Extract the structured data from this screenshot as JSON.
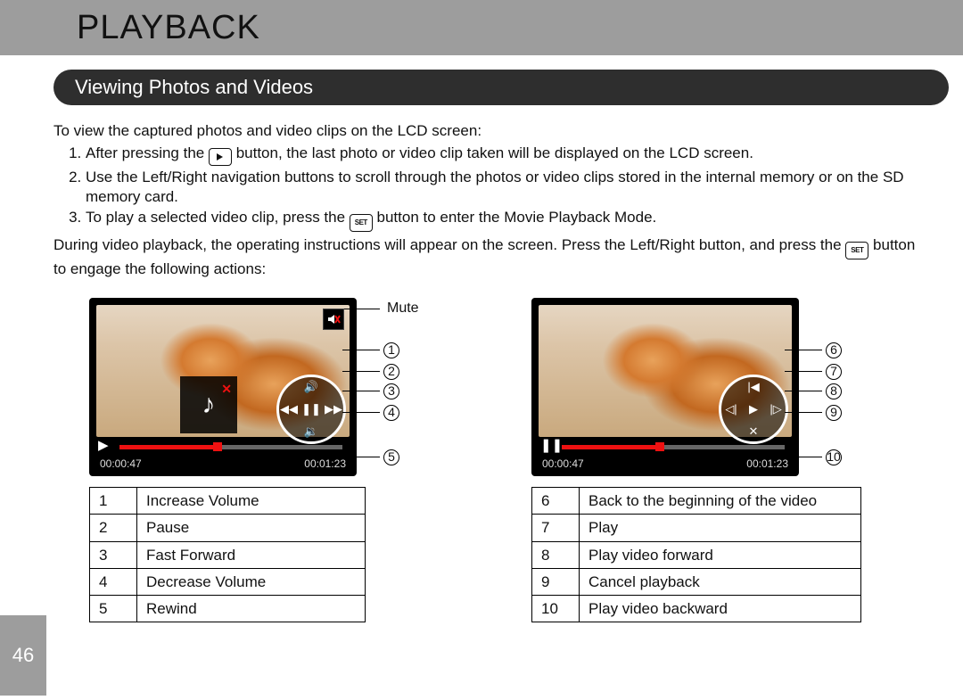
{
  "page_number": "46",
  "title": "PLAYBACK",
  "section_title": "Viewing Photos and Videos",
  "intro": "To view the captured photos and video clips on the LCD screen:",
  "step1_a": "After pressing the ",
  "step1_b": " button, the last photo or video clip taken will be displayed on the LCD screen.",
  "step2": "Use the Left/Right navigation buttons to scroll through the photos or video clips stored in the internal memory or on the SD memory card.",
  "step3_a": "To play a selected video clip, press the ",
  "step3_b": " button to enter the Movie Playback Mode.",
  "para2_a": "During video playback, the operating instructions will appear on the screen. Press the Left/Right button, and press the ",
  "para2_b": " button to engage the following actions:",
  "mute_label": "Mute",
  "time_elapsed": "00:00:47",
  "time_total": "00:01:23",
  "legend_left": [
    {
      "n": "1",
      "t": "Increase Volume"
    },
    {
      "n": "2",
      "t": "Pause"
    },
    {
      "n": "3",
      "t": "Fast Forward"
    },
    {
      "n": "4",
      "t": "Decrease Volume"
    },
    {
      "n": "5",
      "t": "Rewind"
    }
  ],
  "legend_right": [
    {
      "n": "6",
      "t": "Back to the beginning of the video"
    },
    {
      "n": "7",
      "t": "Play"
    },
    {
      "n": "8",
      "t": "Play video forward"
    },
    {
      "n": "9",
      "t": "Cancel playback"
    },
    {
      "n": "10",
      "t": "Play video backward"
    }
  ],
  "callouts_left": [
    "1",
    "2",
    "3",
    "4",
    "5"
  ],
  "callouts_right": [
    "6",
    "7",
    "8",
    "9",
    "10"
  ]
}
